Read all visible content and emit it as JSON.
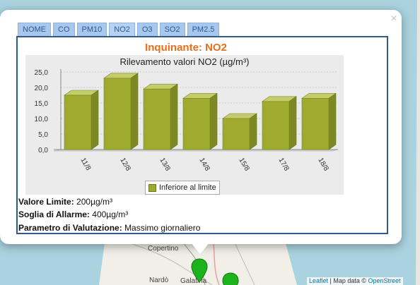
{
  "popup": {
    "close_glyph": "×",
    "tabs": [
      {
        "label": "NOME"
      },
      {
        "label": "CO"
      },
      {
        "label": "PM10"
      },
      {
        "label": "NO2"
      },
      {
        "label": "O3"
      },
      {
        "label": "SO2"
      },
      {
        "label": "PM2.5"
      }
    ],
    "active_tab": "NO2",
    "heading": "Inquinante: NO2",
    "info": {
      "limit_label": "Valore Limite:",
      "limit_value": "200µg/m³",
      "alarm_label": "Soglia di Allarme:",
      "alarm_value": "400µg/m³",
      "param_label": "Parametro di Valutazione:",
      "param_value": "Massimo giornaliero"
    }
  },
  "chart_data": {
    "type": "bar",
    "title": "Rilevamento valori NO2 (µg/m³)",
    "categories": [
      "11/8",
      "12/8",
      "13/8",
      "14/8",
      "15/8",
      "17/8",
      "18/8"
    ],
    "series": [
      {
        "name": "Inferiore al limite",
        "values": [
          17.5,
          23,
          19.5,
          16.5,
          10,
          15.5,
          16.5
        ],
        "color": "#9fab2f"
      }
    ],
    "yticks": [
      "0,0",
      "5,0",
      "10,0",
      "15,0",
      "20,0",
      "25,0"
    ],
    "ylim": [
      0,
      25
    ],
    "grid": true,
    "legend_position": "bottom-center"
  },
  "map": {
    "places": [
      "Copertino",
      "Nardò",
      "Galatina"
    ],
    "attribution_leaflet": "Leaflet",
    "attribution_text": " | Map data © ",
    "attribution_osm": "OpenStreet"
  },
  "colors": {
    "heading": "#e96e1c",
    "bar": "#9fab2f",
    "tab": "#a8c7ec",
    "marker": "#1db31d"
  }
}
